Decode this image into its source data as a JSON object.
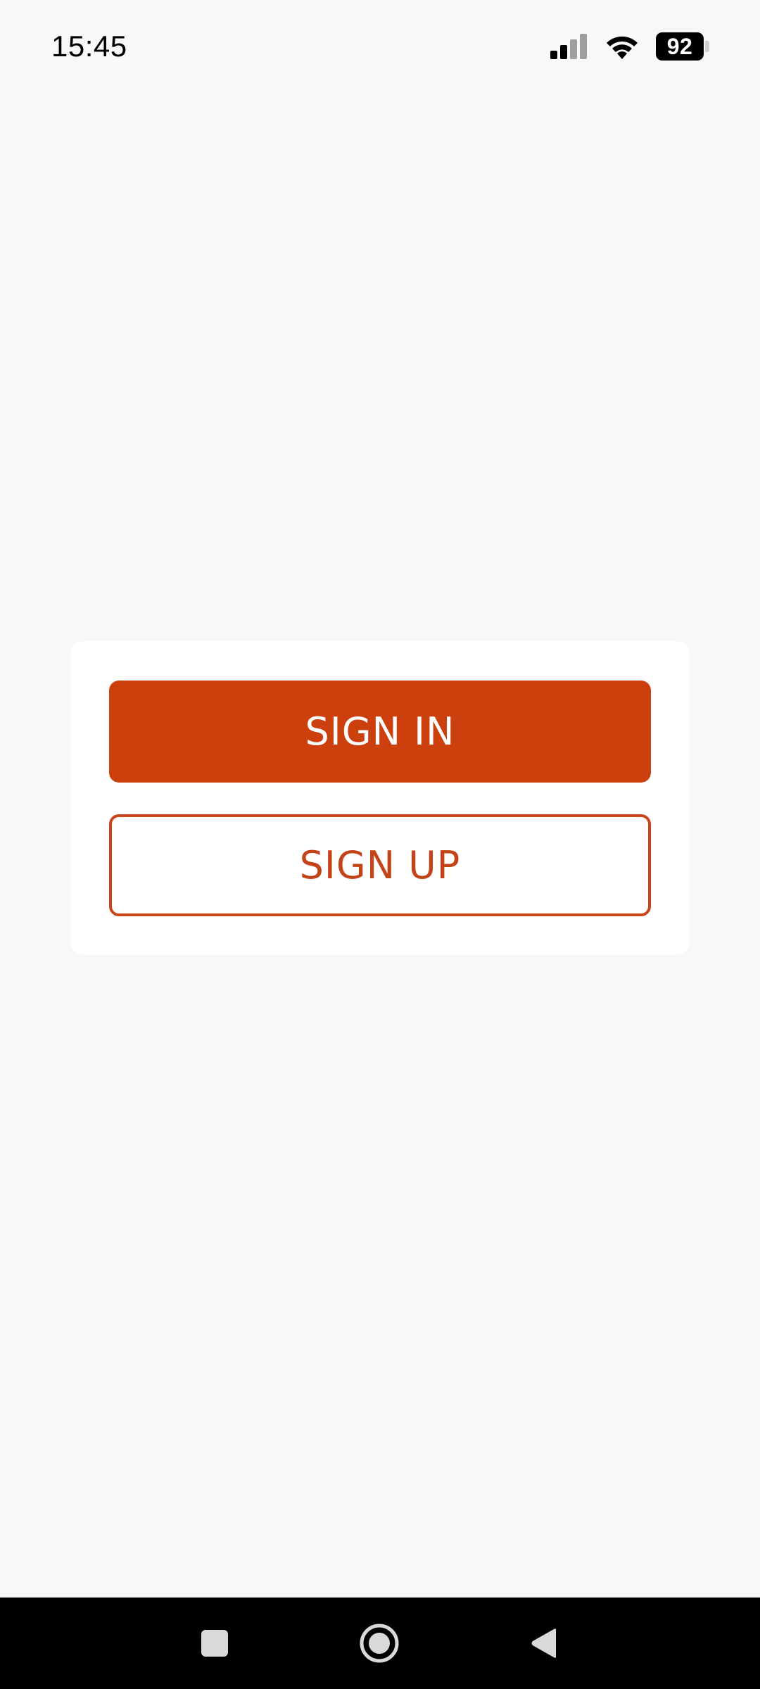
{
  "status_bar": {
    "time": "15:45",
    "battery_level": "92",
    "signal_icon": "cellular-signal-icon",
    "wifi_icon": "wifi-icon",
    "battery_icon": "battery-icon"
  },
  "auth": {
    "sign_in_label": "SIGN IN",
    "sign_up_label": "SIGN UP"
  },
  "colors": {
    "background": "#f8f8f8",
    "card": "#ffffff",
    "accent": "#cc400e",
    "nav_bar": "#000000"
  },
  "nav_bar": {
    "recents_icon": "square-icon",
    "home_icon": "circle-icon",
    "back_icon": "triangle-back-icon"
  }
}
